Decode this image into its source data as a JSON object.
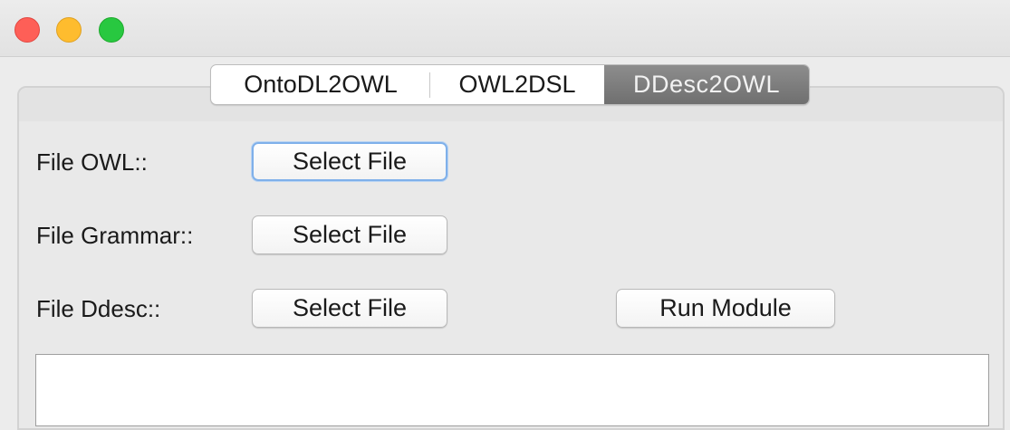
{
  "window": {
    "controls": {
      "close": "close-button",
      "minimize": "minimize-button",
      "maximize": "zoom-button"
    }
  },
  "tabs": [
    {
      "label": "OntoDL2OWL",
      "selected": false
    },
    {
      "label": "OWL2DSL",
      "selected": false
    },
    {
      "label": "DDesc2OWL",
      "selected": true
    }
  ],
  "form": {
    "owl_label": "File OWL::",
    "owl_button": "Select File",
    "grammar_label": "File Grammar::",
    "grammar_button": "Select File",
    "ddesc_label": "File Ddesc::",
    "ddesc_button": "Select File",
    "run_button": "Run Module"
  },
  "output": {
    "value": ""
  },
  "colors": {
    "close": "#fe5f57",
    "minimize": "#febc2e",
    "maximize": "#28c840",
    "selected_tab": "#7d7d7d",
    "focus_ring": "#7fb0ea"
  }
}
